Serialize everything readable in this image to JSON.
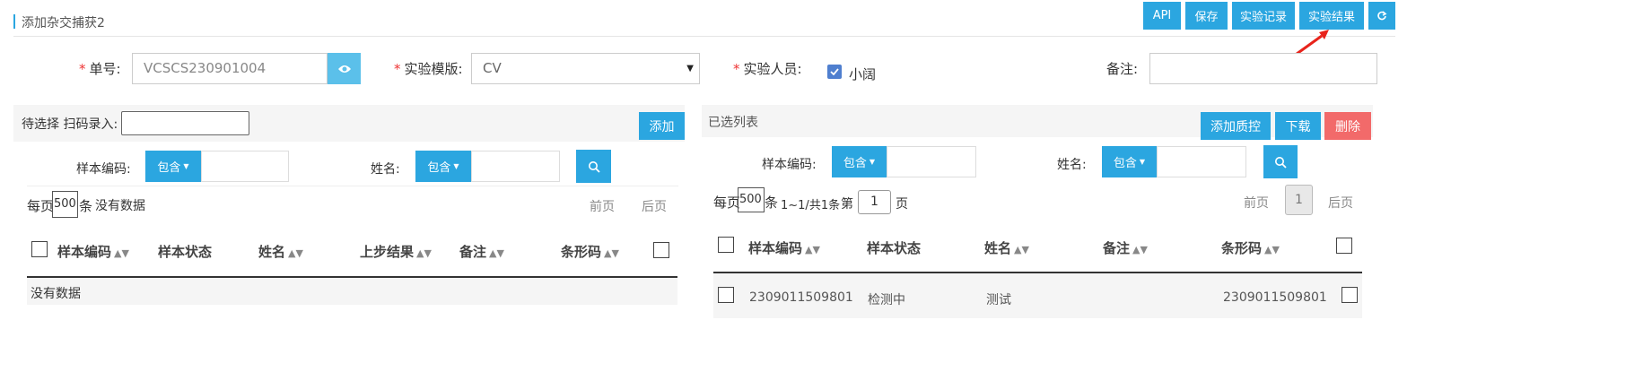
{
  "header": {
    "title": "添加杂交捕获2",
    "buttons": {
      "api": "API",
      "save": "保存",
      "records": "实验记录",
      "results": "实验结果"
    }
  },
  "form": {
    "order_label": "单号:",
    "order_value": "VCSCS230901004",
    "template_label": "实验模版:",
    "template_value": "CV",
    "person_label": "实验人员:",
    "person_name": "小阔",
    "remark_label": "备注:",
    "remark_value": ""
  },
  "left": {
    "scan_label": "待选择 扫码录入:",
    "add_button": "添加",
    "filter_code_label": "样本编码:",
    "filter_name_label": "姓名:",
    "contains_label": "包含",
    "page_size_prefix": "每页",
    "page_size": "500",
    "page_size_suffix": "条",
    "no_data_info": "没有数据",
    "prev": "前页",
    "next": "后页",
    "columns": [
      "样本编码",
      "样本状态",
      "姓名",
      "上步结果",
      "备注",
      "条形码"
    ],
    "empty_text": "没有数据"
  },
  "right": {
    "title": "已选列表",
    "add_qc_button": "添加质控",
    "download_button": "下载",
    "delete_button": "删除",
    "filter_code_label": "样本编码:",
    "filter_name_label": "姓名:",
    "contains_label": "包含",
    "page_size_prefix": "每页",
    "page_size": "500",
    "page_size_suffix": "条",
    "range_info": "1~1/共1条",
    "page_prefix": "第",
    "page_value": "1",
    "page_suffix": "页",
    "prev": "前页",
    "current_page": "1",
    "next": "后页",
    "columns": [
      "样本编码",
      "样本状态",
      "姓名",
      "备注",
      "条形码"
    ],
    "rows": [
      {
        "code": "2309011509801",
        "status": "检测中",
        "name": "测试",
        "remark": "",
        "barcode": "2309011509801"
      }
    ]
  },
  "colors": {
    "accent": "#2ba6e0",
    "danger": "#f26a6a",
    "annotation": "#e8231b"
  }
}
